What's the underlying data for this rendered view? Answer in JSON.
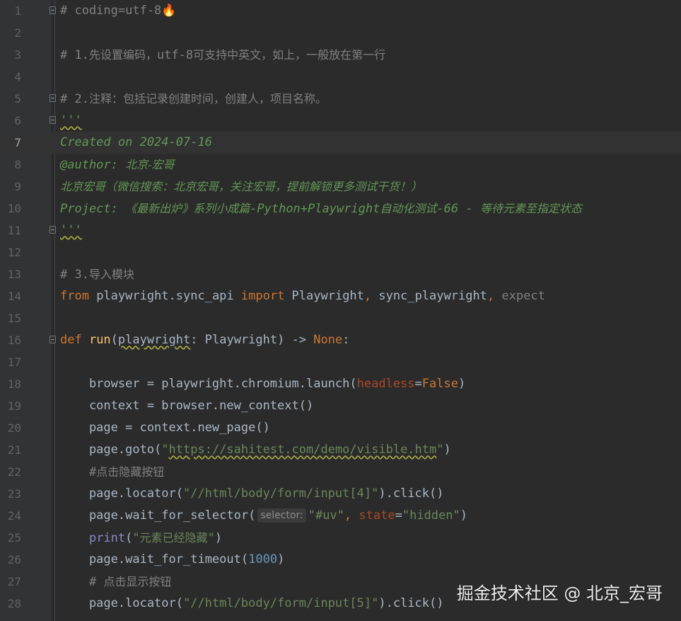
{
  "editor": {
    "current_line": 7,
    "lines": [
      {
        "n": "1",
        "parts": [
          {
            "t": "# coding=utf-8",
            "c": "c-comment"
          },
          {
            "t": "🔥",
            "c": ""
          }
        ]
      },
      {
        "n": "2",
        "parts": []
      },
      {
        "n": "3",
        "parts": [
          {
            "t": "# 1.",
            "c": "c-comment"
          },
          {
            "t": "先设置编码，",
            "c": "c-comment cjk"
          },
          {
            "t": "utf-8",
            "c": "c-comment"
          },
          {
            "t": "可支持中英文，如上，一般放在第一行",
            "c": "c-comment cjk"
          }
        ]
      },
      {
        "n": "4",
        "parts": []
      },
      {
        "n": "5",
        "parts": [
          {
            "t": "# 2.",
            "c": "c-comment"
          },
          {
            "t": "注释：包括记录创建时间，创建人，项目名称。",
            "c": "c-comment cjk"
          }
        ]
      },
      {
        "n": "6",
        "parts": [
          {
            "t": "'''",
            "c": "c-doc squiggle"
          }
        ]
      },
      {
        "n": "7",
        "parts": [
          {
            "t": "Created on 2024-07-16",
            "c": "c-doc"
          }
        ]
      },
      {
        "n": "8",
        "parts": [
          {
            "t": "@author: ",
            "c": "c-doc"
          },
          {
            "t": "北京-宏哥",
            "c": "c-doc cjk-i"
          }
        ]
      },
      {
        "n": "9",
        "parts": [
          {
            "t": "北京宏哥（微信搜索：北京宏哥，关注宏哥，提前解锁更多测试干货！）",
            "c": "c-doc cjk-i"
          }
        ]
      },
      {
        "n": "10",
        "parts": [
          {
            "t": "Project: ",
            "c": "c-doc"
          },
          {
            "t": "《最新出炉》系列小成篇",
            "c": "c-doc cjk-i"
          },
          {
            "t": "-Python+Playwright",
            "c": "c-doc"
          },
          {
            "t": "自动化测试",
            "c": "c-doc cjk-i"
          },
          {
            "t": "-66 - ",
            "c": "c-doc"
          },
          {
            "t": "等待元素至指定状态",
            "c": "c-doc cjk-i"
          }
        ]
      },
      {
        "n": "11",
        "parts": [
          {
            "t": "'''",
            "c": "c-doc squiggle"
          }
        ]
      },
      {
        "n": "12",
        "parts": []
      },
      {
        "n": "13",
        "parts": [
          {
            "t": "# 3.",
            "c": "c-comment"
          },
          {
            "t": "导入模块",
            "c": "c-comment cjk"
          }
        ]
      },
      {
        "n": "14",
        "parts": [
          {
            "t": "from ",
            "c": "c-kw"
          },
          {
            "t": "playwright.sync_api ",
            "c": ""
          },
          {
            "t": "import ",
            "c": "c-kw"
          },
          {
            "t": "Playwright",
            "c": ""
          },
          {
            "t": ", ",
            "c": "c-kw"
          },
          {
            "t": "sync_playwright",
            "c": ""
          },
          {
            "t": ", ",
            "c": "c-kw"
          },
          {
            "t": "expect",
            "c": "c-dim"
          }
        ]
      },
      {
        "n": "15",
        "parts": []
      },
      {
        "n": "16",
        "parts": [
          {
            "t": "def ",
            "c": "c-kw"
          },
          {
            "t": "run",
            "c": "c-fn"
          },
          {
            "t": "(",
            "c": ""
          },
          {
            "t": "playwright",
            "c": "squiggle"
          },
          {
            "t": ": Playwright) -> ",
            "c": ""
          },
          {
            "t": "None",
            "c": "c-kw"
          },
          {
            "t": ":",
            "c": ""
          }
        ]
      },
      {
        "n": "17",
        "parts": []
      },
      {
        "n": "18",
        "parts": [
          {
            "t": "    browser = playwright.chromium.launch(",
            "c": ""
          },
          {
            "t": "headless",
            "c": "c-param"
          },
          {
            "t": "=",
            "c": ""
          },
          {
            "t": "False",
            "c": "c-kw"
          },
          {
            "t": ")",
            "c": ""
          }
        ]
      },
      {
        "n": "19",
        "parts": [
          {
            "t": "    context = browser.new_context()",
            "c": ""
          }
        ]
      },
      {
        "n": "20",
        "parts": [
          {
            "t": "    page = context.new_page()",
            "c": ""
          }
        ]
      },
      {
        "n": "21",
        "parts": [
          {
            "t": "    page.goto(",
            "c": ""
          },
          {
            "t": "\"",
            "c": "c-str"
          },
          {
            "t": "https://sahitest.com/demo/visible.htm",
            "c": "c-str squiggle"
          },
          {
            "t": "\"",
            "c": "c-str"
          },
          {
            "t": ")",
            "c": ""
          }
        ]
      },
      {
        "n": "22",
        "parts": [
          {
            "t": "    #",
            "c": "c-comment"
          },
          {
            "t": "点击隐藏按钮",
            "c": "c-comment cjk"
          }
        ]
      },
      {
        "n": "23",
        "parts": [
          {
            "t": "    page.locator(",
            "c": ""
          },
          {
            "t": "\"//html/body/form/input[4]\"",
            "c": "c-str"
          },
          {
            "t": ").click()",
            "c": ""
          }
        ]
      },
      {
        "n": "24",
        "parts": [
          {
            "t": "    page.wait_for_selector(",
            "c": ""
          },
          {
            "t": "selector:",
            "c": "hint"
          },
          {
            "t": "\"#uv\"",
            "c": "c-str"
          },
          {
            "t": ", ",
            "c": "c-kw"
          },
          {
            "t": "state",
            "c": "c-param"
          },
          {
            "t": "=",
            "c": ""
          },
          {
            "t": "\"hidden\"",
            "c": "c-str"
          },
          {
            "t": ")",
            "c": ""
          }
        ]
      },
      {
        "n": "25",
        "parts": [
          {
            "t": "    ",
            "c": ""
          },
          {
            "t": "print",
            "c": "c-builtin"
          },
          {
            "t": "(",
            "c": ""
          },
          {
            "t": "\"",
            "c": "c-str"
          },
          {
            "t": "元素已经隐藏",
            "c": "c-str cjk"
          },
          {
            "t": "\"",
            "c": "c-str"
          },
          {
            "t": ")",
            "c": ""
          }
        ]
      },
      {
        "n": "26",
        "parts": [
          {
            "t": "    page.wait_for_timeout(",
            "c": ""
          },
          {
            "t": "1000",
            "c": "c-num"
          },
          {
            "t": ")",
            "c": ""
          }
        ]
      },
      {
        "n": "27",
        "parts": [
          {
            "t": "    # ",
            "c": "c-comment"
          },
          {
            "t": "点击显示按钮",
            "c": "c-comment cjk"
          }
        ]
      },
      {
        "n": "28",
        "parts": [
          {
            "t": "    page.locator(",
            "c": ""
          },
          {
            "t": "\"//html/body/form/input[5]\"",
            "c": "c-str"
          },
          {
            "t": ").click()",
            "c": ""
          }
        ]
      }
    ],
    "fold_lines": [
      1,
      5,
      6,
      11,
      16
    ]
  },
  "watermark": {
    "text": "掘金技术社区 @ 北京_宏哥"
  }
}
